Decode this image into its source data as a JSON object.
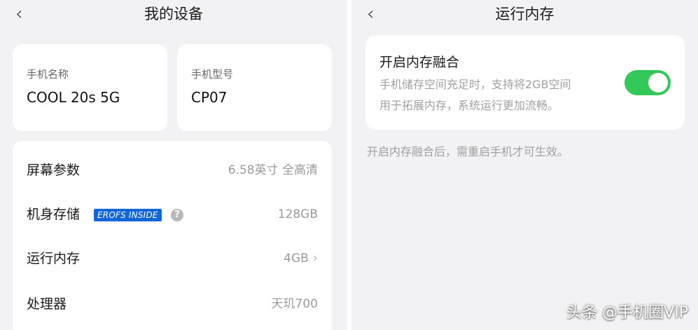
{
  "left": {
    "title": "我的设备",
    "back_icon": "‹",
    "device_name": {
      "label": "手机名称",
      "value": "COOL 20s 5G"
    },
    "device_model": {
      "label": "手机型号",
      "value": "CP07"
    },
    "specs": [
      {
        "label": "屏幕参数",
        "value": "6.58英寸 全高清"
      },
      {
        "label": "机身存储",
        "badge": "EROFS INSIDE",
        "help": "?",
        "value": "128GB"
      },
      {
        "label": "运行内存",
        "value": "4GB",
        "chevron": "›"
      },
      {
        "label": "处理器",
        "value": "天玑700"
      }
    ]
  },
  "right": {
    "title": "运行内存",
    "back_icon": "‹",
    "memory_fusion": {
      "title": "开启内存融合",
      "desc_line1": "手机储存空间充足时，支持将2GB空间",
      "desc_line2": "用于拓展内存，系统运行更加流畅。",
      "enabled": true
    },
    "note": "开启内存融合后，需重启手机才可生效。"
  },
  "watermark": "头条 @手机圈VIP",
  "colors": {
    "background": "#f2f2f4",
    "card": "#ffffff",
    "toggle_on": "#34c759",
    "badge": "#1366d8"
  }
}
